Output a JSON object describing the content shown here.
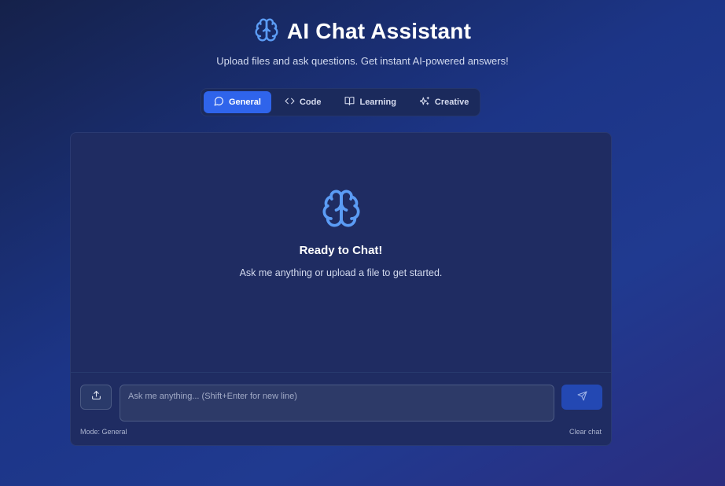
{
  "header": {
    "title": "AI Chat Assistant",
    "subtitle": "Upload files and ask questions. Get instant AI-powered answers!",
    "icon": "brain-icon"
  },
  "tabs": [
    {
      "label": "General",
      "icon": "message-circle-icon",
      "active": true
    },
    {
      "label": "Code",
      "icon": "code-icon",
      "active": false
    },
    {
      "label": "Learning",
      "icon": "book-open-icon",
      "active": false
    },
    {
      "label": "Creative",
      "icon": "sparkles-icon",
      "active": false
    }
  ],
  "empty_state": {
    "icon": "brain-icon",
    "title": "Ready to Chat!",
    "message": "Ask me anything or upload a file to get started."
  },
  "composer": {
    "placeholder": "Ask me anything... (Shift+Enter for new line)",
    "value": "",
    "mode_label": "Mode: General",
    "clear_label": "Clear chat",
    "upload_icon": "upload-icon",
    "send_icon": "send-icon"
  },
  "colors": {
    "accent": "#2f64eb",
    "brain_icon": "#5b9cf5",
    "panel": "#1f2c62"
  }
}
